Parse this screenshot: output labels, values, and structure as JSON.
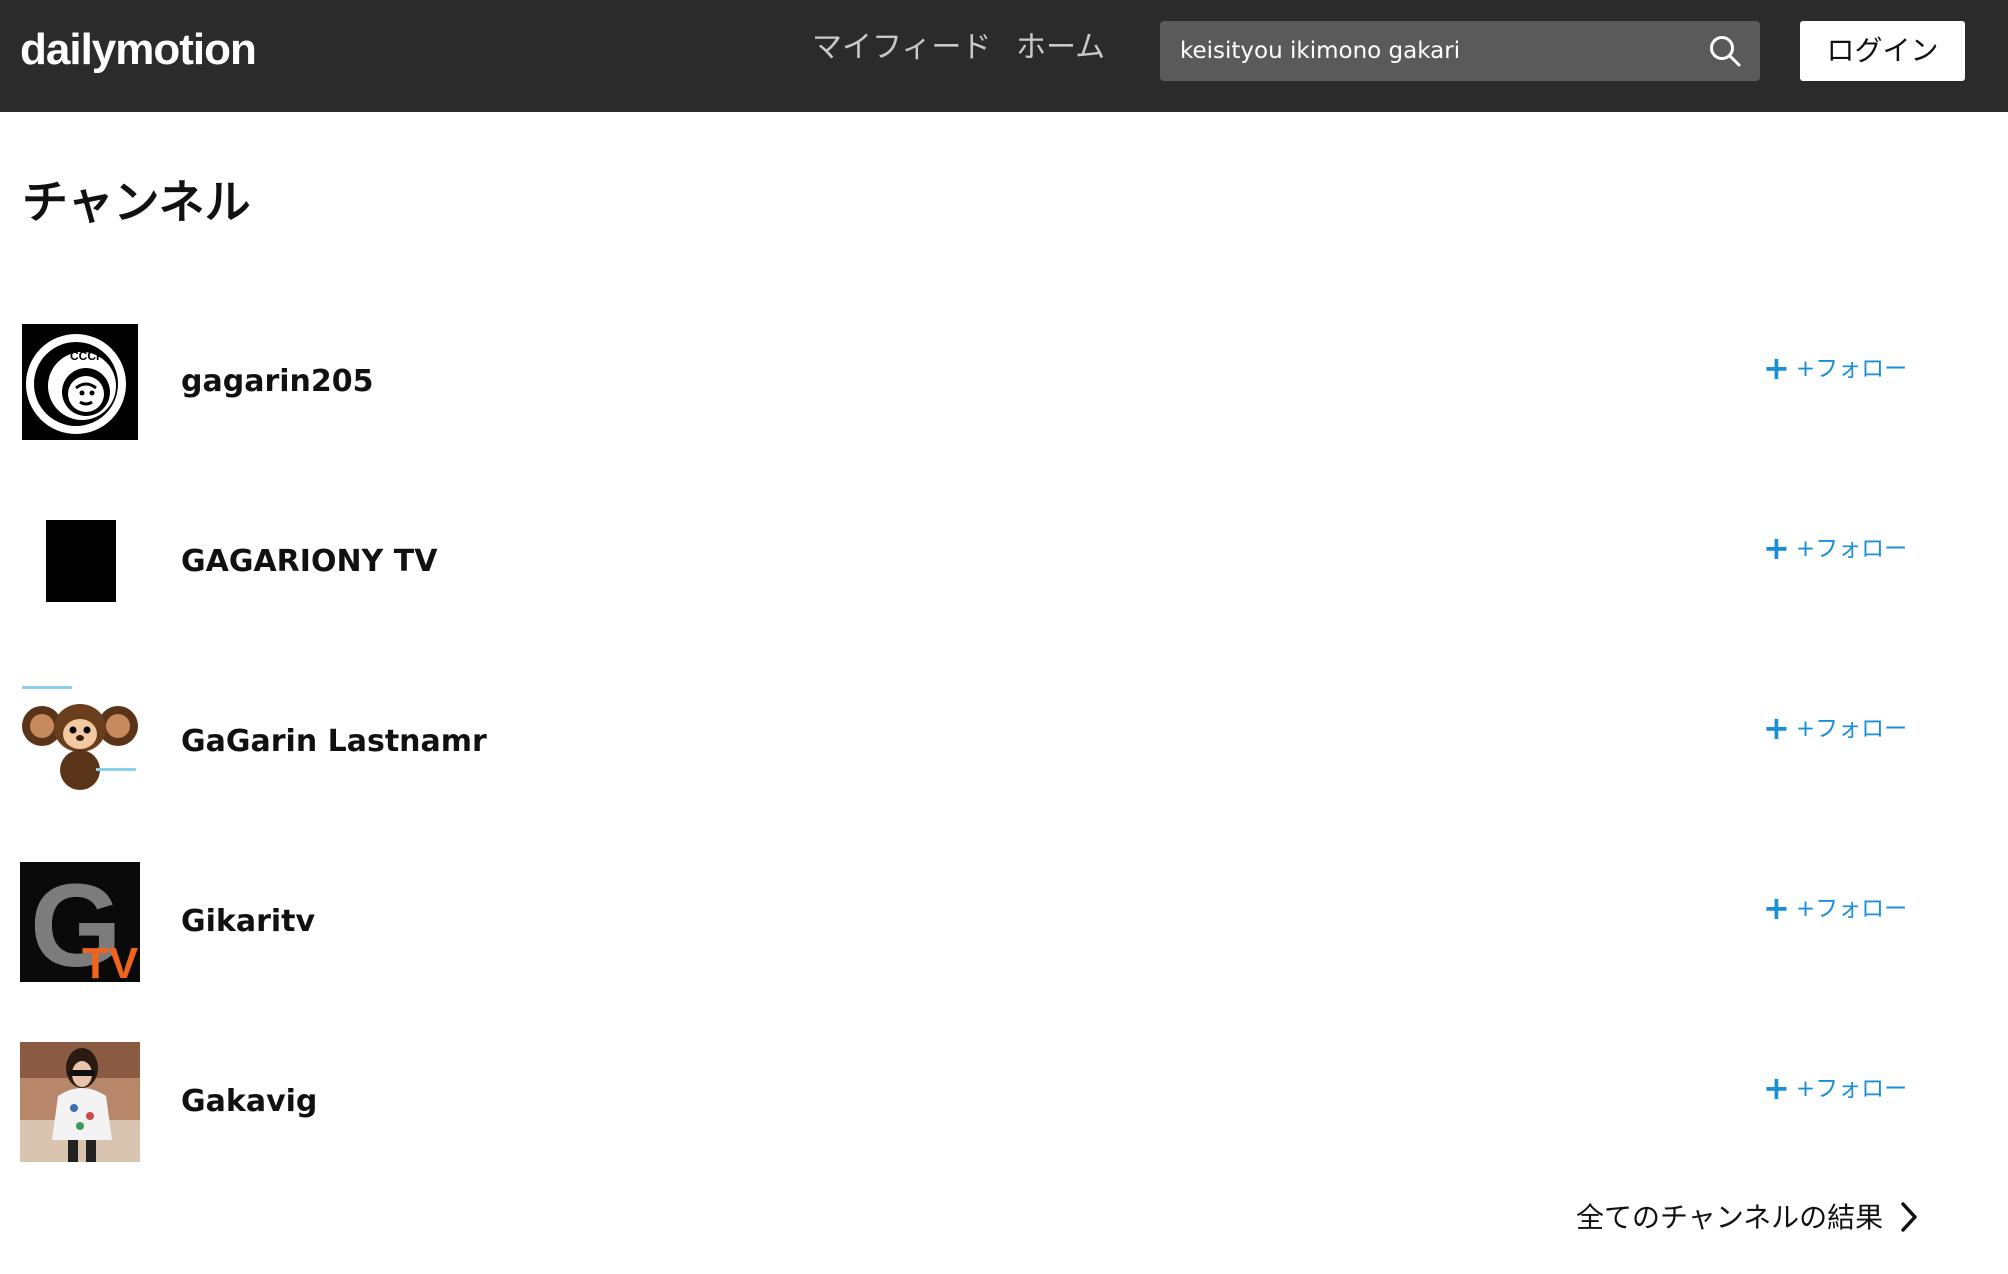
{
  "header": {
    "logo": "dailymotion",
    "nav": {
      "feed": "マイフィード",
      "home": "ホーム"
    },
    "search": {
      "value": "keisityou ikimono gakari"
    },
    "login_label": "ログイン"
  },
  "section": {
    "title": "チャンネル"
  },
  "channels": [
    {
      "name": "gagarin205",
      "follow_label": "+フォロー",
      "avatar_text": "CCCP"
    },
    {
      "name": "GAGARIONY TV",
      "follow_label": "+フォロー"
    },
    {
      "name": "GaGarin Lastnamr",
      "follow_label": "+フォロー"
    },
    {
      "name": "Gikaritv",
      "follow_label": "+フォロー",
      "avatar_letter": "G",
      "avatar_tv": "TV"
    },
    {
      "name": "Gakavig",
      "follow_label": "+フォロー"
    }
  ],
  "all_results_label": "全てのチャンネルの結果",
  "colors": {
    "header_bg": "#2b2b2b",
    "accent": "#1a8fd9",
    "search_bg": "#5a5a5a"
  }
}
